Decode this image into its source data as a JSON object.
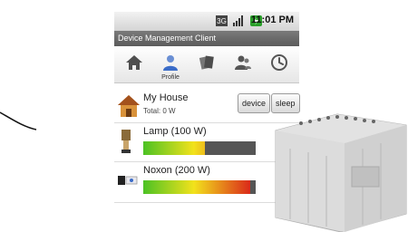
{
  "statusbar": {
    "time": "11:01 PM",
    "network_label": "3G"
  },
  "app": {
    "title": "Device Management Client"
  },
  "toolbar": {
    "items": [
      {
        "icon": "home-icon"
      },
      {
        "icon": "profile-icon",
        "label": "Profile"
      },
      {
        "icon": "devices-icon"
      },
      {
        "icon": "users-icon"
      },
      {
        "icon": "timer-icon"
      }
    ]
  },
  "house": {
    "title": "My House",
    "total": "Total: 0 W",
    "device_button": "device",
    "sleep_button": "sleep"
  },
  "devices": [
    {
      "name": "Lamp (100 W)",
      "level_percent": 55
    },
    {
      "name": "Noxon (200 W)",
      "level_percent": 95
    }
  ],
  "colors": {
    "titlebar": "#666666",
    "meter_start": "#4cc224",
    "meter_mid": "#f2e21c",
    "meter_end": "#d8171a",
    "meter_track": "#555555"
  }
}
